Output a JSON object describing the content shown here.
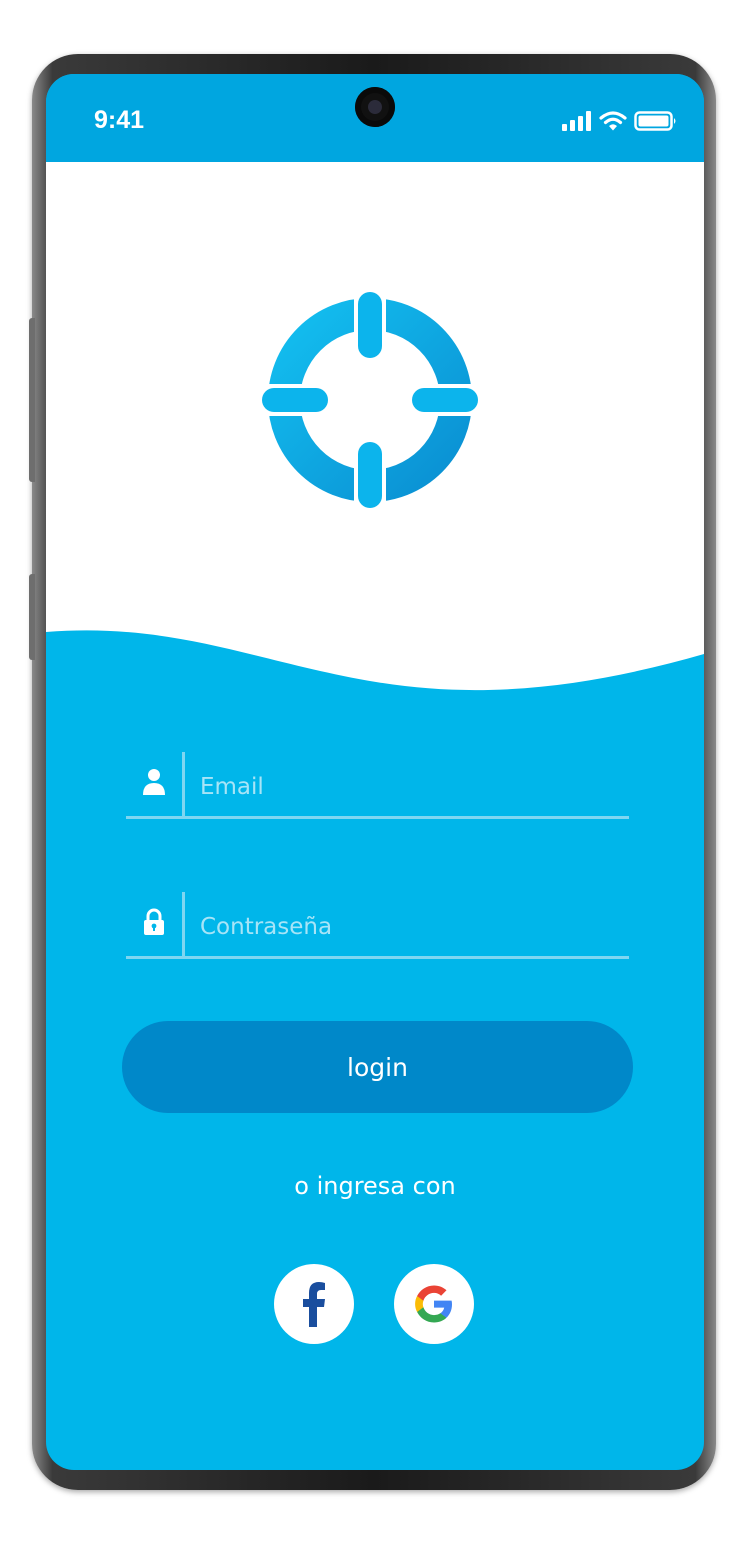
{
  "status_bar": {
    "time": "9:41",
    "icons": [
      "signal-icon",
      "wifi-icon",
      "battery-icon"
    ]
  },
  "logo": {
    "icon": "crosshair-logo-icon"
  },
  "form": {
    "email_placeholder": "Email",
    "email_icon": "user-icon",
    "password_placeholder": "Contraseña",
    "password_icon": "lock-icon",
    "login_label": "login"
  },
  "alt_login": {
    "label": "o ingresa con",
    "providers": [
      {
        "name": "facebook",
        "icon": "facebook-icon"
      },
      {
        "name": "google",
        "icon": "google-icon"
      }
    ]
  },
  "colors": {
    "accent": "#00b6ea",
    "status_bar": "#00a6e0",
    "button": "#0088c9",
    "logo": "#0aa8e4",
    "facebook": "#1a4e9e"
  }
}
